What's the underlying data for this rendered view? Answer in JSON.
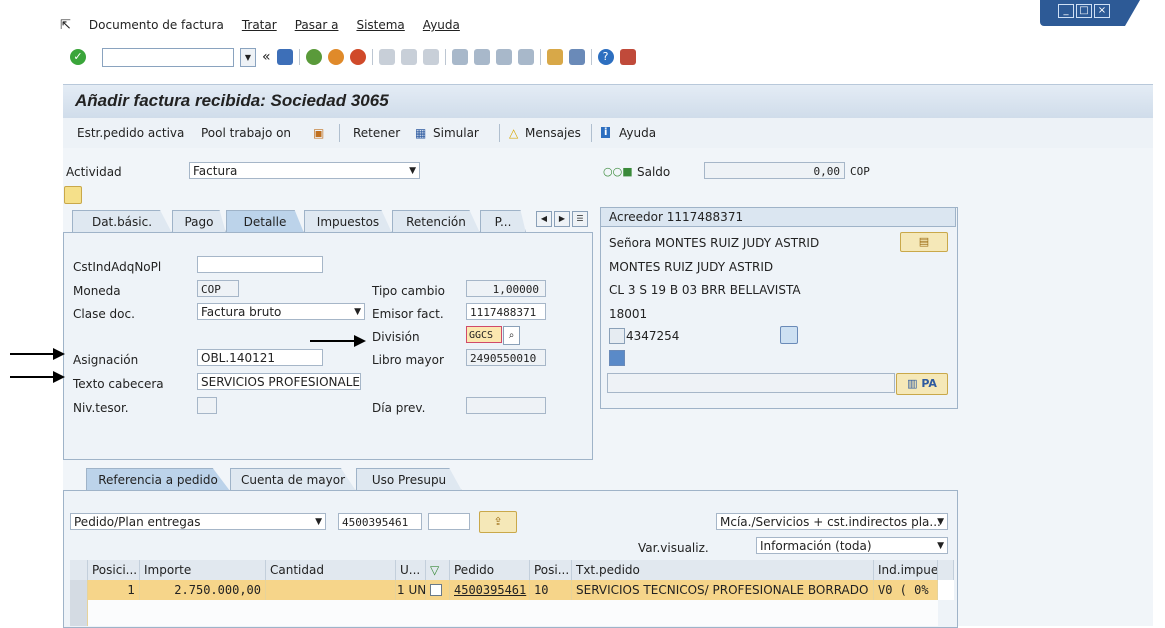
{
  "menu": {
    "items": [
      "Documento de factura",
      "Tratar",
      "Pasar a",
      "Sistema",
      "Ayuda"
    ]
  },
  "title": "Añadir factura recibida: Sociedad 3065",
  "app_toolbar": {
    "estr_pedido": "Estr.pedido activa",
    "pool": "Pool trabajo on",
    "retener": "Retener",
    "simular": "Simular",
    "mensajes": "Mensajes",
    "ayuda": "Ayuda"
  },
  "header": {
    "actividad_label": "Actividad",
    "actividad_value": "Factura",
    "saldo_label": "Saldo",
    "saldo_value": "0,00",
    "saldo_currency": "COP"
  },
  "tabs": [
    "Dat.básic.",
    "Pago",
    "Detalle",
    "Impuestos",
    "Retención",
    "P..."
  ],
  "detalle": {
    "cst_label": "CstIndAdqNoPl",
    "moneda_label": "Moneda",
    "moneda_value": "COP",
    "clase_label": "Clase doc.",
    "clase_value": "Factura bruto",
    "asignacion_label": "Asignación",
    "asignacion_value": "OBL.140121",
    "texto_label": "Texto cabecera",
    "texto_value": "SERVICIOS PROFESIONALES",
    "nivtesor_label": "Niv.tesor.",
    "tipocambio_label": "Tipo cambio",
    "tipocambio_value": "1,00000",
    "emisor_label": "Emisor fact.",
    "emisor_value": "1117488371",
    "division_label": "División",
    "division_value": "GGCS",
    "libro_label": "Libro mayor",
    "libro_value": "2490550010",
    "diaprev_label": "Día prev."
  },
  "acreedor": {
    "title": "Acreedor 1117488371",
    "line1": "Señora MONTES RUIZ JUDY ASTRID",
    "line2": "MONTES RUIZ JUDY ASTRID",
    "line3": "CL 3 S 19 B 03 BRR BELLAVISTA",
    "line4": "18001",
    "phone": "4347254",
    "pa": "PA"
  },
  "lower_tabs": [
    "Referencia a pedido",
    "Cuenta de mayor",
    "Uso Presupu"
  ],
  "pedido": {
    "tipo": "Pedido/Plan entregas",
    "numero": "4500395461",
    "mcia": "Mcía./Servicios + cst.indirectos pla...",
    "varvisual_label": "Var.visualiz.",
    "varvisual_value": "Información (toda)"
  },
  "grid": {
    "headers": [
      "Posici...",
      "Importe",
      "Cantidad",
      "U...",
      "",
      "Pedido",
      "Posi...",
      "Txt.pedido",
      "Ind.impue"
    ],
    "rows": [
      [
        "1",
        "2.750.000,00",
        "",
        "1 UN",
        "",
        "4500395461",
        "10",
        "SERVICIOS TECNICOS/ PROFESIONALE BORRADO",
        "V0 ( 0%"
      ]
    ]
  },
  "colors": {
    "accent": "#bcd3ea",
    "row_highlight": "#f6d58a",
    "title_bg": "#dbe6f1"
  }
}
